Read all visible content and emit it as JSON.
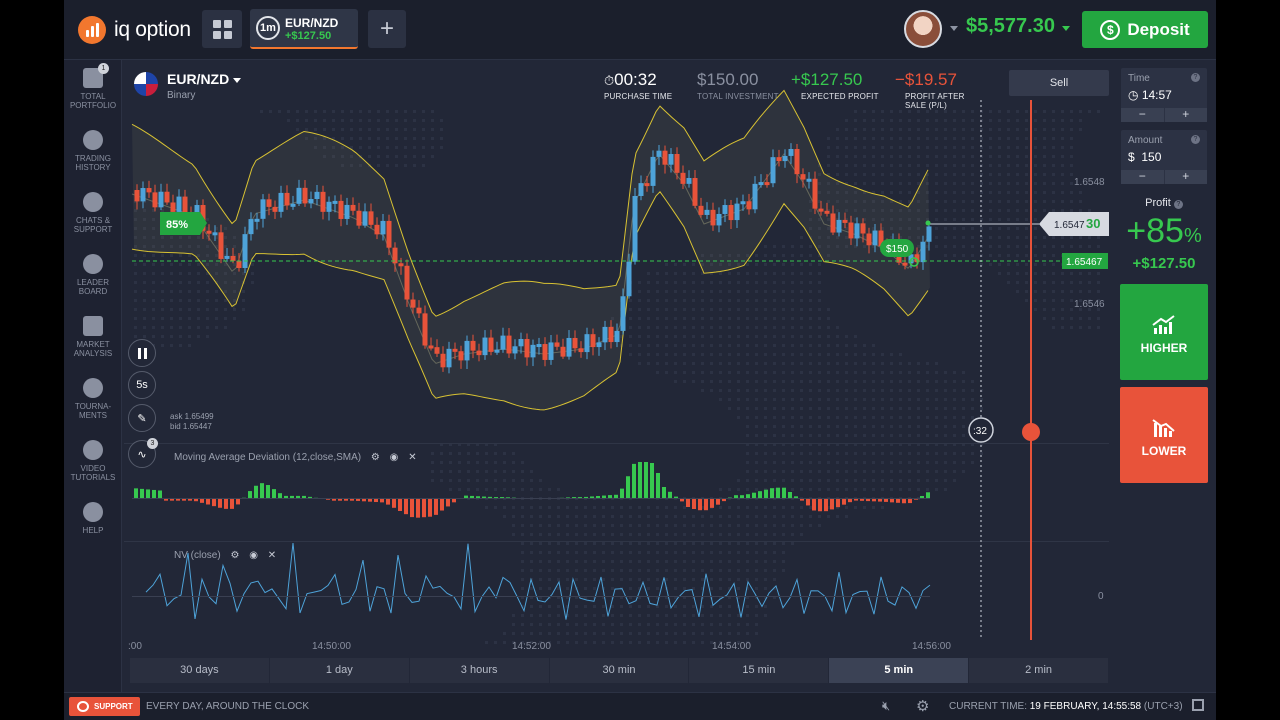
{
  "header": {
    "logo_text": "iq option",
    "asset_tab": {
      "timeframe": "1m",
      "name": "EUR/NZD",
      "profit": "+$127.50"
    },
    "add_tab": "+",
    "balance": "$5,577.30",
    "deposit_label": "Deposit"
  },
  "sidebar": {
    "items": [
      {
        "label": "TOTAL PORTFOLIO",
        "badge": "1"
      },
      {
        "label": "TRADING HISTORY"
      },
      {
        "label": "CHATS & SUPPORT"
      },
      {
        "label": "LEADER BOARD"
      },
      {
        "label": "MARKET ANALYSIS"
      },
      {
        "label": "TOURNA-MENTS"
      },
      {
        "label": "VIDEO TUTORIALS"
      },
      {
        "label": "HELP"
      }
    ]
  },
  "chart_header": {
    "pair": "EUR/NZD",
    "type": "Binary",
    "stats": [
      {
        "value": "00:32",
        "label": "PURCHASE TIME"
      },
      {
        "value": "$150.00",
        "label": "TOTAL INVESTMENT"
      },
      {
        "value": "+$127.50",
        "label": "EXPECTED PROFIT"
      },
      {
        "value": "−$19.57",
        "label": "PROFIT AFTER SALE (P/L)"
      }
    ],
    "sell_label": "Sell"
  },
  "chart": {
    "payout_badge": "85%",
    "investment_tag": "$150",
    "current_price_main": "1.6547",
    "current_price_last": "30",
    "strike_price": "1.65467",
    "y_ticks": [
      "1.6548",
      "1.6546"
    ],
    "x_ticks": [
      "14:50:00",
      "14:52:00",
      "14:54:00",
      "14:56:00"
    ],
    "x_tick_left_partial": ":00",
    "countdown": ":32",
    "ask": "ask 1.65499",
    "bid": "bid 1.65447",
    "tools": [
      "candles",
      "5s",
      "draw",
      "indicators"
    ],
    "indicator_count": "3",
    "indicator1_title": "Moving Average Deviation (12,close,SMA)",
    "indicator2_title": "NV (close)",
    "indicator2_zero": "0",
    "colors": {
      "up": "#4ea3d9",
      "down": "#e8533a",
      "bands": "#d8c233",
      "green": "#37c84f",
      "red": "#e8533a"
    }
  },
  "right_panel": {
    "time_label": "Time",
    "time_value": "14:57",
    "amount_label": "Amount",
    "amount_value": "$  150",
    "minus": "−",
    "plus": "+",
    "profit_label": "Profit",
    "profit_percent": "+85",
    "profit_percent_sign": "%",
    "profit_value": "+$127.50",
    "higher_label": "HIGHER",
    "lower_label": "LOWER"
  },
  "timeframes": [
    {
      "label": "30 days"
    },
    {
      "label": "1 day"
    },
    {
      "label": "3 hours"
    },
    {
      "label": "30 min"
    },
    {
      "label": "15 min"
    },
    {
      "label": "5 min",
      "active": true
    },
    {
      "label": "2 min"
    }
  ],
  "status_bar": {
    "support_label": "SUPPORT",
    "message": "EVERY DAY, AROUND THE CLOCK",
    "current_time_label": "CURRENT TIME:",
    "current_time_value": "19 FEBRUARY, 14:55:58",
    "utc": "(UTC+3)"
  }
}
